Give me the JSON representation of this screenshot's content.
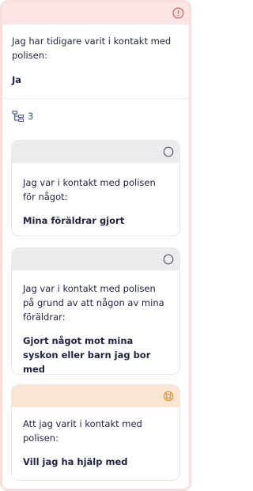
{
  "question": {
    "text": "Jag har tidigare varit i kontakt med polisen:",
    "answer": "Ja"
  },
  "subtree": {
    "count": "3"
  },
  "cards": [
    {
      "text": "Jag var i kontakt med polisen för något:",
      "answer": "Mina föräldrar gjort",
      "status_icon": "circle-outline-icon"
    },
    {
      "text": "Jag var i kontakt med polisen på grund av att någon av mina föräldrar:",
      "answer": "Gjort något mot mina syskon eller barn jag bor med",
      "status_icon": "circle-outline-icon"
    },
    {
      "text": "Att jag varit i kontakt med polisen:",
      "answer": "Vill jag ha hjälp med",
      "status_icon": "lifebuoy-icon"
    }
  ],
  "colors": {
    "alert": "#e0565b",
    "header_pink": "#fbe4e4",
    "card_grey": "#ececee",
    "card_peach": "#fbe6d4",
    "lifebuoy": "#e0913a",
    "text_dark": "#1f2340",
    "link_blue": "#3a4a8c"
  }
}
